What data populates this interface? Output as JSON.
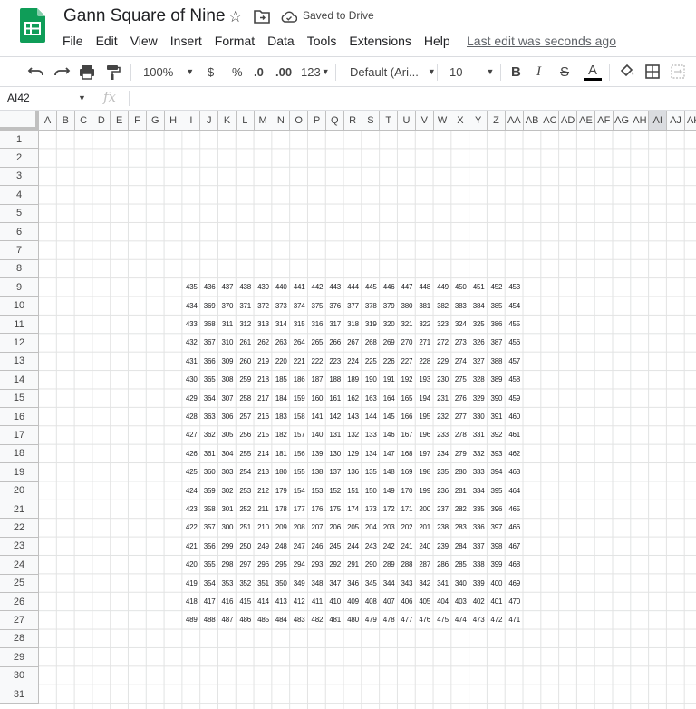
{
  "app": {
    "title": "Gann Square of Nine",
    "saved_status": "Saved to Drive",
    "last_edit": "Last edit was seconds ago",
    "accent_color": "#0f9d58"
  },
  "menu": [
    "File",
    "Edit",
    "View",
    "Insert",
    "Format",
    "Data",
    "Tools",
    "Extensions",
    "Help"
  ],
  "toolbar": {
    "zoom": "100%",
    "currency": "$",
    "percent": "%",
    "decrease_decimal": ".0",
    "increase_decimal": ".00",
    "number_format": "123",
    "font": "Default (Ari...",
    "font_size": "10",
    "bold": "B",
    "italic": "I",
    "strikethrough": "S",
    "text_color": "A"
  },
  "formula_bar": {
    "name_box": "AI42",
    "fx": "fx"
  },
  "columns": [
    "A",
    "B",
    "C",
    "D",
    "E",
    "F",
    "G",
    "H",
    "I",
    "J",
    "K",
    "L",
    "M",
    "N",
    "O",
    "P",
    "Q",
    "R",
    "S",
    "T",
    "U",
    "V",
    "W",
    "X",
    "Y",
    "Z",
    "AA",
    "AB",
    "AC",
    "AD",
    "AE",
    "AF",
    "AG",
    "AH",
    "AI",
    "AJ",
    "AK"
  ],
  "selected_column": "AI",
  "rows": [
    "1",
    "2",
    "3",
    "4",
    "5",
    "6",
    "7",
    "8",
    "9",
    "10",
    "11",
    "12",
    "13",
    "14",
    "15",
    "16",
    "17",
    "18",
    "19",
    "20",
    "21",
    "22",
    "23",
    "24",
    "25",
    "26",
    "27",
    "28",
    "29",
    "30",
    "31"
  ],
  "data_start_row": 9,
  "data_start_col": "I",
  "square": [
    [
      "435",
      "436",
      "437",
      "438",
      "439",
      "440",
      "441",
      "442",
      "443",
      "444",
      "445",
      "446",
      "447",
      "448",
      "449",
      "450",
      "451",
      "452",
      "453"
    ],
    [
      "434",
      "369",
      "370",
      "371",
      "372",
      "373",
      "374",
      "375",
      "376",
      "377",
      "378",
      "379",
      "380",
      "381",
      "382",
      "383",
      "384",
      "385",
      "454"
    ],
    [
      "433",
      "368",
      "311",
      "312",
      "313",
      "314",
      "315",
      "316",
      "317",
      "318",
      "319",
      "320",
      "321",
      "322",
      "323",
      "324",
      "325",
      "386",
      "455"
    ],
    [
      "432",
      "367",
      "310",
      "261",
      "262",
      "263",
      "264",
      "265",
      "266",
      "267",
      "268",
      "269",
      "270",
      "271",
      "272",
      "273",
      "326",
      "387",
      "456"
    ],
    [
      "431",
      "366",
      "309",
      "260",
      "219",
      "220",
      "221",
      "222",
      "223",
      "224",
      "225",
      "226",
      "227",
      "228",
      "229",
      "274",
      "327",
      "388",
      "457"
    ],
    [
      "430",
      "365",
      "308",
      "259",
      "218",
      "185",
      "186",
      "187",
      "188",
      "189",
      "190",
      "191",
      "192",
      "193",
      "230",
      "275",
      "328",
      "389",
      "458"
    ],
    [
      "429",
      "364",
      "307",
      "258",
      "217",
      "184",
      "159",
      "160",
      "161",
      "162",
      "163",
      "164",
      "165",
      "194",
      "231",
      "276",
      "329",
      "390",
      "459"
    ],
    [
      "428",
      "363",
      "306",
      "257",
      "216",
      "183",
      "158",
      "141",
      "142",
      "143",
      "144",
      "145",
      "166",
      "195",
      "232",
      "277",
      "330",
      "391",
      "460"
    ],
    [
      "427",
      "362",
      "305",
      "256",
      "215",
      "182",
      "157",
      "140",
      "131",
      "132",
      "133",
      "146",
      "167",
      "196",
      "233",
      "278",
      "331",
      "392",
      "461"
    ],
    [
      "426",
      "361",
      "304",
      "255",
      "214",
      "181",
      "156",
      "139",
      "130",
      "129",
      "134",
      "147",
      "168",
      "197",
      "234",
      "279",
      "332",
      "393",
      "462"
    ],
    [
      "425",
      "360",
      "303",
      "254",
      "213",
      "180",
      "155",
      "138",
      "137",
      "136",
      "135",
      "148",
      "169",
      "198",
      "235",
      "280",
      "333",
      "394",
      "463"
    ],
    [
      "424",
      "359",
      "302",
      "253",
      "212",
      "179",
      "154",
      "153",
      "152",
      "151",
      "150",
      "149",
      "170",
      "199",
      "236",
      "281",
      "334",
      "395",
      "464"
    ],
    [
      "423",
      "358",
      "301",
      "252",
      "211",
      "178",
      "177",
      "176",
      "175",
      "174",
      "173",
      "172",
      "171",
      "200",
      "237",
      "282",
      "335",
      "396",
      "465"
    ],
    [
      "422",
      "357",
      "300",
      "251",
      "210",
      "209",
      "208",
      "207",
      "206",
      "205",
      "204",
      "203",
      "202",
      "201",
      "238",
      "283",
      "336",
      "397",
      "466"
    ],
    [
      "421",
      "356",
      "299",
      "250",
      "249",
      "248",
      "247",
      "246",
      "245",
      "244",
      "243",
      "242",
      "241",
      "240",
      "239",
      "284",
      "337",
      "398",
      "467"
    ],
    [
      "420",
      "355",
      "298",
      "297",
      "296",
      "295",
      "294",
      "293",
      "292",
      "291",
      "290",
      "289",
      "288",
      "287",
      "286",
      "285",
      "338",
      "399",
      "468"
    ],
    [
      "419",
      "354",
      "353",
      "352",
      "351",
      "350",
      "349",
      "348",
      "347",
      "346",
      "345",
      "344",
      "343",
      "342",
      "341",
      "340",
      "339",
      "400",
      "469"
    ],
    [
      "418",
      "417",
      "416",
      "415",
      "414",
      "413",
      "412",
      "411",
      "410",
      "409",
      "408",
      "407",
      "406",
      "405",
      "404",
      "403",
      "402",
      "401",
      "470"
    ],
    [
      "489",
      "488",
      "487",
      "486",
      "485",
      "484",
      "483",
      "482",
      "481",
      "480",
      "479",
      "478",
      "477",
      "476",
      "475",
      "474",
      "473",
      "472",
      "471"
    ]
  ]
}
